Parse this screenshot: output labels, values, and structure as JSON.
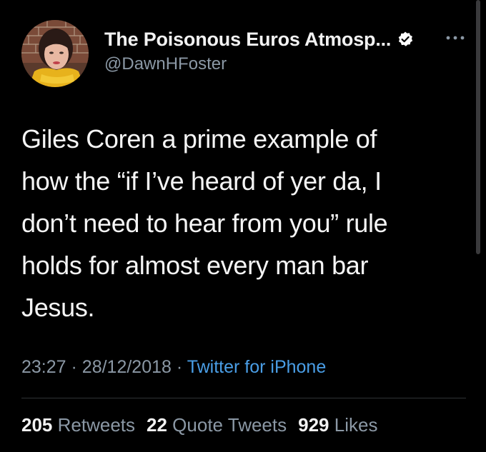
{
  "tweet": {
    "display_name": "The Poisonous Euros Atmosp...",
    "handle": "@DawnHFoster",
    "verified_icon": "verified-badge-icon",
    "more_icon": "more-dots-icon",
    "text": "Giles Coren a prime example of\nhow the “if I’ve heard of yer da, I\ndon’t need to hear from you” rule\nholds for almost every man bar\nJesus.",
    "time": "23:27",
    "date": "28/12/2018",
    "sep": "·",
    "source": "Twitter for iPhone"
  },
  "stats": {
    "retweets_count": "205",
    "retweets_label": "Retweets",
    "quotes_count": "22",
    "quotes_label": "Quote Tweets",
    "likes_count": "929",
    "likes_label": "Likes"
  },
  "colors": {
    "background": "#000000",
    "text": "#f5f5f5",
    "muted": "#8b98a5",
    "link": "#4a9ee6",
    "divider": "#2f3336"
  }
}
